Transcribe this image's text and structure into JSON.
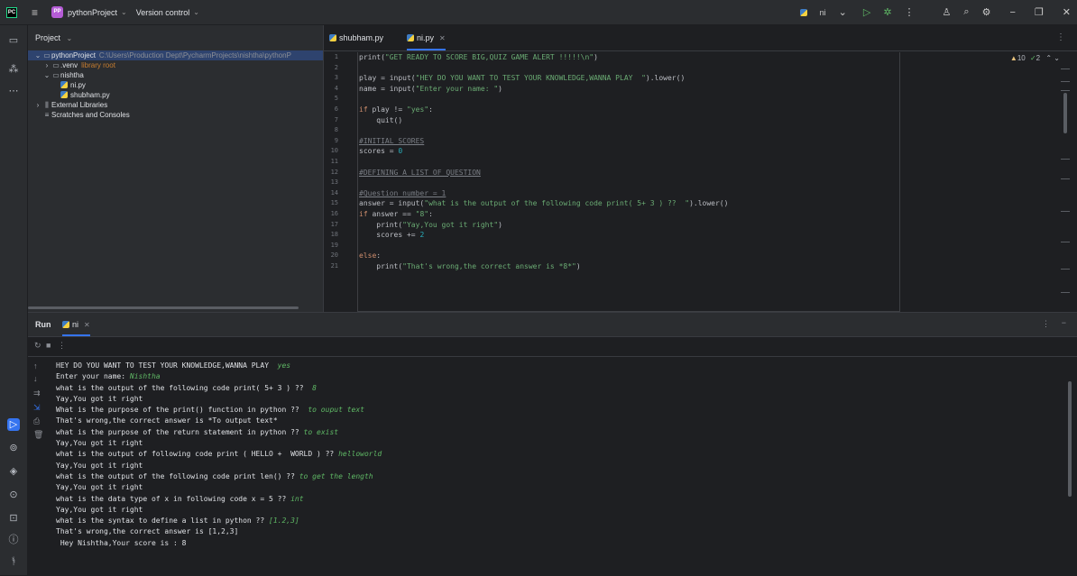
{
  "titlebar": {
    "project_badge": "PP",
    "project_name": "pythonProject",
    "version_control": "Version control",
    "run_config": "ni"
  },
  "project_pane": {
    "title": "Project",
    "tree": [
      {
        "label": "pythonProject",
        "extra": "C:\\Users\\Production Dept\\PycharmProjects\\nishtha\\pythonP",
        "indent": 0,
        "arrow": "⌄",
        "icon": "folder"
      },
      {
        "label": ".venv",
        "extra": "library root",
        "indent": 1,
        "arrow": "›",
        "icon": "folder"
      },
      {
        "label": "nishtha",
        "extra": "",
        "indent": 1,
        "arrow": "⌄",
        "icon": "folder"
      },
      {
        "label": "ni.py",
        "extra": "",
        "indent": 2,
        "arrow": "",
        "icon": "python"
      },
      {
        "label": "shubham.py",
        "extra": "",
        "indent": 2,
        "arrow": "",
        "icon": "python"
      },
      {
        "label": "External Libraries",
        "extra": "",
        "indent": 0,
        "arrow": "›",
        "icon": "library"
      },
      {
        "label": "Scratches and Consoles",
        "extra": "",
        "indent": 0,
        "arrow": "",
        "icon": "scratch"
      }
    ]
  },
  "editor": {
    "tabs": [
      {
        "label": "shubham.py"
      },
      {
        "label": "ni.py"
      }
    ],
    "inspection": {
      "warnings": "10",
      "checks": "2"
    },
    "line_numbers": [
      "1",
      "2",
      "3",
      "4",
      "5",
      "6",
      "7",
      "8",
      "9",
      "10",
      "11",
      "12",
      "13",
      "14",
      "15",
      "16",
      "17",
      "18",
      "19",
      "20",
      "21"
    ]
  },
  "run": {
    "title": "Run",
    "tab": "ni",
    "output": [
      {
        "text": "HEY DO YOU WANT TO TEST YOUR KNOWLEDGE,WANNA PLAY  ",
        "input": "yes"
      },
      {
        "text": "Enter your name: ",
        "input": "Nishtha"
      },
      {
        "text": "what is the output of the following code print( 5+ 3 ) ??  ",
        "input": "8"
      },
      {
        "text": "Yay,You got it right",
        "input": ""
      },
      {
        "text": "What is the purpose of the print() function in python ??  ",
        "input": "to ouput text"
      },
      {
        "text": "That's wrong,the correct answer is *To output text*",
        "input": ""
      },
      {
        "text": "what is the purpose of the return statement in python ?? ",
        "input": "to exist"
      },
      {
        "text": "Yay,You got it right",
        "input": ""
      },
      {
        "text": "what is the output of following code print ( HELLO +  WORLD ) ?? ",
        "input": "helloworld"
      },
      {
        "text": "Yay,You got it right",
        "input": ""
      },
      {
        "text": "what is the output of the following code print len() ?? ",
        "input": "to get the length"
      },
      {
        "text": "Yay,You got it right",
        "input": ""
      },
      {
        "text": "what is the data type of x in following code x = 5 ?? ",
        "input": "int"
      },
      {
        "text": "Yay,You got it right",
        "input": ""
      },
      {
        "text": "what is the syntax to define a list in python ?? ",
        "input": "[1.2,3]"
      },
      {
        "text": "That's wrong,the correct answer is [1,2,3]",
        "input": ""
      },
      {
        "text": " Hey Nishtha,Your score is : 8",
        "input": ""
      }
    ]
  },
  "colors": {
    "accent": "#3574f0",
    "bg": "#1e1f22",
    "panel": "#2b2d30"
  }
}
